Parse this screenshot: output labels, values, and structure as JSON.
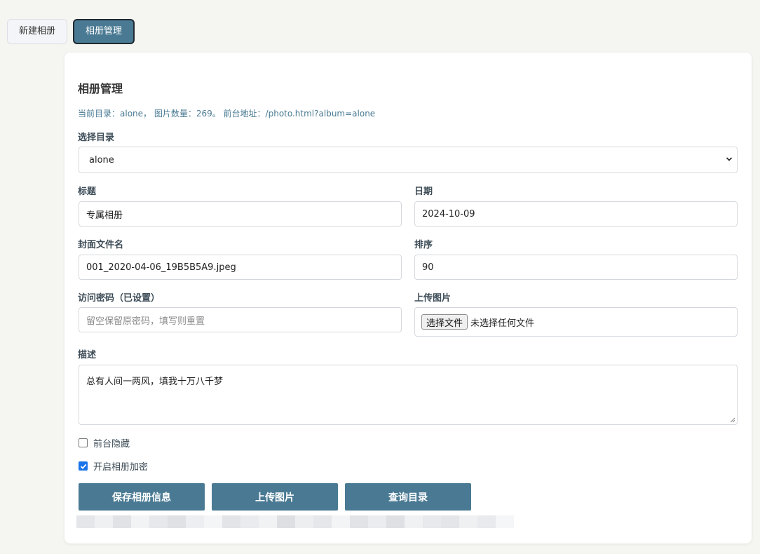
{
  "tabs": [
    {
      "label": "新建相册",
      "active": false
    },
    {
      "label": "相册管理",
      "active": true
    }
  ],
  "card": {
    "title": "相册管理",
    "info": "当前目录：alone， 图片数量：269。 前台地址：/photo.html?album=alone"
  },
  "form": {
    "directory": {
      "label": "选择目录",
      "value": "alone"
    },
    "title": {
      "label": "标题",
      "value": "专属相册"
    },
    "date": {
      "label": "日期",
      "value": "2024-10-09"
    },
    "cover": {
      "label": "封面文件名",
      "value": "001_2020-04-06_19B5B5A9.jpeg"
    },
    "sort": {
      "label": "排序",
      "value": "90"
    },
    "password": {
      "label": "访问密码（已设置）",
      "placeholder": "留空保留原密码，填写则重置"
    },
    "upload": {
      "label": "上传图片",
      "button": "选择文件",
      "status": "未选择任何文件"
    },
    "description": {
      "label": "描述",
      "value": "总有人间一两风，填我十万八千梦"
    },
    "hide_frontend": {
      "label": "前台隐藏",
      "checked": false
    },
    "encrypt": {
      "label": "开启相册加密",
      "checked": true
    }
  },
  "buttons": {
    "save": "保存相册信息",
    "upload": "上传图片",
    "query": "查询目录"
  },
  "colors": {
    "accent": "#4a7a93",
    "background": "#f5f5f1",
    "checkbox": "#1a73e8"
  }
}
